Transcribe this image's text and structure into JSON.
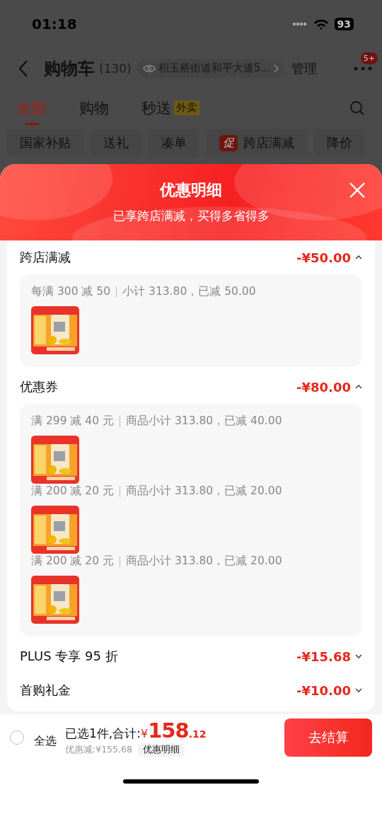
{
  "status_bar": {
    "time": "01:18",
    "battery": "93"
  },
  "nav": {
    "title": "购物车",
    "count": "(130)",
    "location": "积玉桥街道和平大道5...",
    "manage": "管理",
    "badge": "5+"
  },
  "tabs": [
    {
      "label": "全部",
      "selected": true
    },
    {
      "label": "购物",
      "selected": false
    },
    {
      "label": "秒送",
      "selected": false,
      "tag": "外卖"
    }
  ],
  "filters": [
    {
      "label": "国家补贴"
    },
    {
      "label": "送礼"
    },
    {
      "label": "凑单"
    },
    {
      "label": "跨店满减",
      "tag": "促"
    },
    {
      "label": "降价"
    }
  ],
  "sheet": {
    "title": "优惠明细",
    "subtitle": "已享跨店满减，买得多省得多",
    "sections": [
      {
        "title": "跨店满减",
        "amount": "-¥50.00",
        "expanded": true,
        "rules": [
          {
            "condition": "每满 300 减 50",
            "detail": "小计 313.80，已减 50.00"
          }
        ]
      },
      {
        "title": "优惠券",
        "amount": "-¥80.00",
        "expanded": true,
        "rules": [
          {
            "condition": "满 299 减 40 元",
            "detail": "商品小计 313.80，已减 40.00"
          },
          {
            "condition": "满 200 减 20 元",
            "detail": "商品小计 313.80，已减 20.00"
          },
          {
            "condition": "满 200 减 20 元",
            "detail": "商品小计 313.80，已减 20.00"
          }
        ]
      },
      {
        "title": "PLUS 专享 95 折",
        "amount": "-¥15.68",
        "expanded": false
      },
      {
        "title": "首购礼金",
        "amount": "-¥10.00",
        "expanded": false
      }
    ]
  },
  "checkout": {
    "select_all": "全选",
    "checked": false,
    "summary": "已选1件,合计:",
    "currency": "¥",
    "total_int": "158",
    "total_dec": ".12",
    "savings": "优惠减:¥155.68",
    "details": "优惠明细",
    "button": "去结算"
  }
}
